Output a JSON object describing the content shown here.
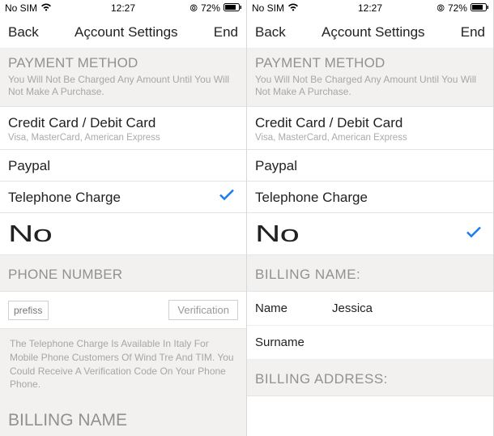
{
  "left": {
    "status": {
      "carrier": "No SIM",
      "time": "12:27",
      "battery": "72%"
    },
    "nav": {
      "back": "Back",
      "title": "Açcount Settings",
      "end": "End"
    },
    "payment_section": {
      "title": "PAYMENT METHOD",
      "sub": "You Will Not Be Charged Any Amount Until You Will Not Make A Purchase."
    },
    "credit": {
      "title": "Credit Card / Debit Card",
      "sub": "Visa, MasterCard, American Express"
    },
    "paypal": {
      "title": "Paypal"
    },
    "telephone": {
      "title": "Telephone Charge"
    },
    "no": {
      "title": "No"
    },
    "phone_section": {
      "title": "PHONE NUMBER"
    },
    "inputs": {
      "prefix_placeholder": "prefisso",
      "verify_label": "Verification"
    },
    "info": {
      "text": "The Telephone Charge Is Available In Italy For Mobile Phone Customers Of Wind Tre And TIM. You Could Receive A Verification Code On Your Phone\nPhone."
    },
    "billing": {
      "title": "BILLING NAME"
    }
  },
  "right": {
    "status": {
      "carrier": "No SIM",
      "time": "12:27",
      "battery": "72%"
    },
    "nav": {
      "back": "Back",
      "title": "Açcount Settings",
      "end": "End"
    },
    "payment_section": {
      "title": "PAYMENT METHOD",
      "sub": "You Will Not Be Charged Any Amount Until You Will Not Make A Purchase."
    },
    "credit": {
      "title": "Credit Card / Debit Card",
      "sub": "Visa, MasterCard, American Express"
    },
    "paypal": {
      "title": "Paypal"
    },
    "telephone": {
      "title": "Telephone Charge"
    },
    "no": {
      "title": "No"
    },
    "billing_name": {
      "title": "BILLING NAME:"
    },
    "fields": {
      "name_label": "Name",
      "name_value": "Jessica",
      "surname_label": "Surname"
    },
    "billing_address": {
      "title": "BILLING ADDRESS:"
    }
  }
}
